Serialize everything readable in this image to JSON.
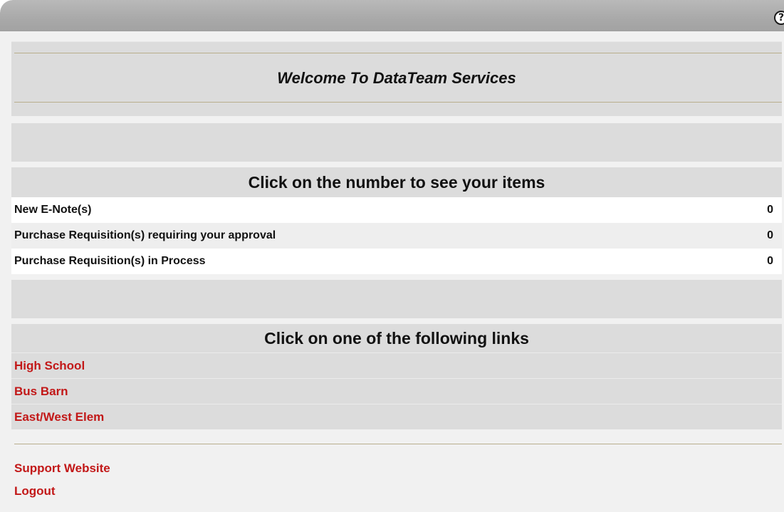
{
  "header": {
    "help_glyph": "?",
    "help_icon": "help-circle-icon"
  },
  "welcome": {
    "title": "Welcome To DataTeam Services"
  },
  "items_section": {
    "heading": "Click on the number to see your items",
    "rows": [
      {
        "label": "New E-Note(s)",
        "count": "0"
      },
      {
        "label": "Purchase Requisition(s) requiring your approval",
        "count": "0"
      },
      {
        "label": "Purchase Requisition(s) in Process",
        "count": "0"
      }
    ]
  },
  "links_section": {
    "heading": "Click on one of the following links",
    "links": [
      "High School",
      "Bus Barn",
      "East/West Elem"
    ]
  },
  "footer": {
    "links": [
      "Support Website",
      "Logout"
    ]
  },
  "colors": {
    "link": "#c21818",
    "band": "#dcdcdc",
    "rule": "#b8ae8c",
    "titlebar": "#a9a9a9"
  }
}
